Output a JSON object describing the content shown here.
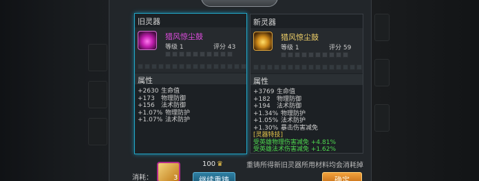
{
  "old": {
    "header": "旧灵器",
    "item_name": "猎风惊尘鼓",
    "level_label": "等级 1",
    "score_label": "评分 43",
    "attr_header": "属性",
    "attrs": [
      {
        "value": "+2630",
        "name": "生命值"
      },
      {
        "value": "+173",
        "name": "物理防御"
      },
      {
        "value": "+156",
        "name": "法术防御"
      },
      {
        "value": "+1.07%",
        "name": "物理防护"
      },
      {
        "value": "+1.07%",
        "name": "法术防护"
      }
    ]
  },
  "new": {
    "header": "新灵器",
    "item_name": "猎风惊尘鼓",
    "level_label": "等级 1",
    "score_label": "评分 59",
    "attr_header": "属性",
    "attrs": [
      {
        "value": "+3769",
        "name": "生命值"
      },
      {
        "value": "+182",
        "name": "物理防御"
      },
      {
        "value": "+194",
        "name": "法术防御"
      },
      {
        "value": "+1.34%",
        "name": "物理防护"
      },
      {
        "value": "+1.05%",
        "name": "法术防护"
      },
      {
        "value": "+1.30%",
        "name": "暴击伤害减免"
      }
    ],
    "skill_title": "[灵器特技]",
    "skill_lines": [
      "受英雄物理伤害减免 +4.81%",
      "受英雄法术伤害减免 +1.62%"
    ]
  },
  "footer": {
    "note": "重铸所得新旧灵器所用材料均会消耗掉",
    "cost_label": "消耗：",
    "cost_count": "3",
    "price": "100",
    "recast_button": "继续重铸",
    "ok_button": "确定"
  },
  "colors": {
    "old_item": "#e04de0",
    "new_item": "#f3d36a",
    "skill_title": "#e2c24a",
    "skill_line": "#4fd84f",
    "old_panel_border": "#22a6c6"
  },
  "icons": {
    "old_item": "purple-drum-icon",
    "new_item": "gold-drum-icon",
    "cost_material": "material-icon",
    "currency": "crown-icon"
  }
}
